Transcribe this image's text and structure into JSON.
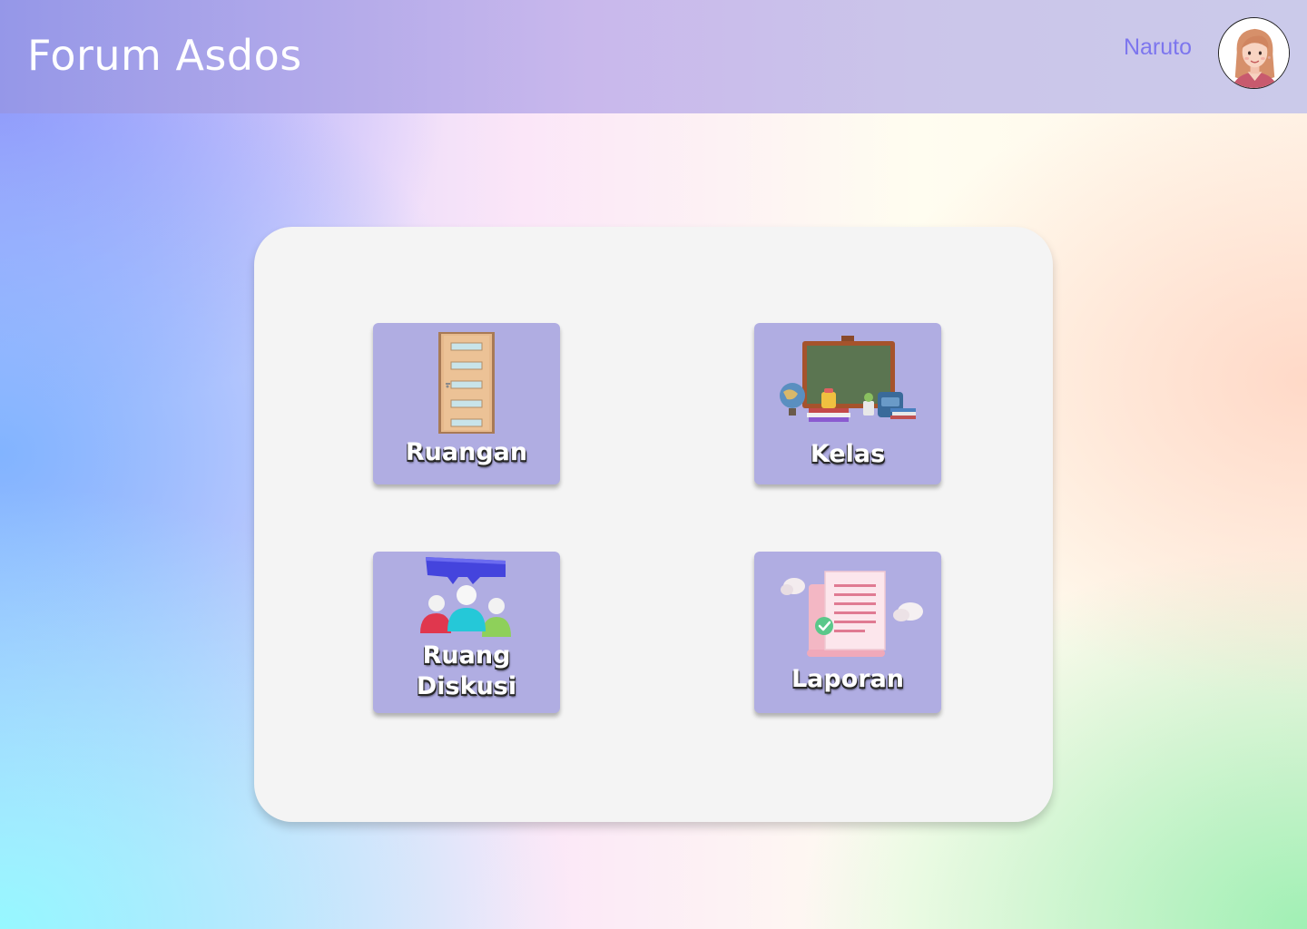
{
  "header": {
    "app_title": "Forum Asdos",
    "user_name": "Naruto"
  },
  "menu": {
    "items": [
      {
        "id": "ruangan",
        "label": "Ruangan",
        "icon": "door-icon"
      },
      {
        "id": "kelas",
        "label": "Kelas",
        "icon": "classroom-blackboard-icon"
      },
      {
        "id": "ruang-diskusi",
        "label": "Ruang\nDiskusi",
        "icon": "discussion-group-icon"
      },
      {
        "id": "laporan",
        "label": "Laporan",
        "icon": "report-document-icon"
      }
    ]
  },
  "colors": {
    "header_gradient_start": "#9597e8",
    "tile_background": "#b0ade2",
    "card_background": "#f4f4f4",
    "user_name": "#7d76ee"
  }
}
